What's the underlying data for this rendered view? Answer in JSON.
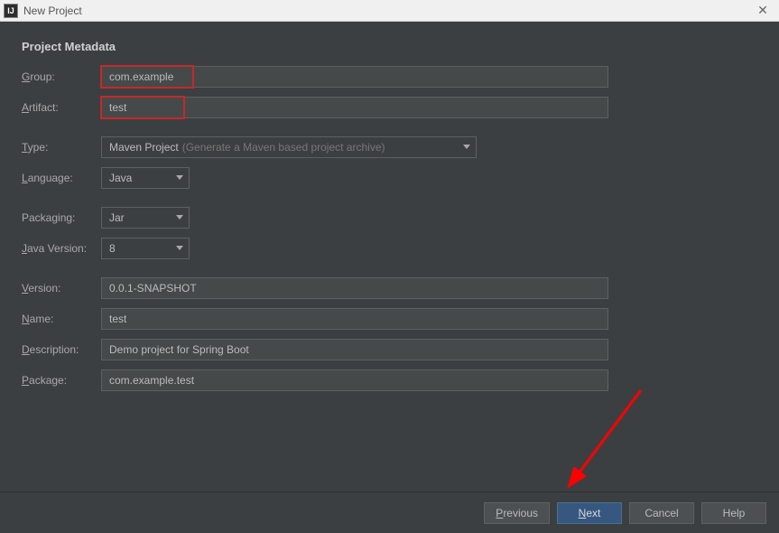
{
  "window": {
    "title": "New Project",
    "app_icon_text": "IJ"
  },
  "section_title": "Project Metadata",
  "labels": {
    "group": "Group:",
    "artifact": "Artifact:",
    "type": "Type:",
    "language": "Language:",
    "packaging": "Packaging:",
    "java_version": "Java Version:",
    "version": "Version:",
    "name": "Name:",
    "description": "Description:",
    "package": "Package:"
  },
  "mnemonics": {
    "group": "G",
    "artifact": "A",
    "type": "T",
    "language": "L",
    "java_version": "J",
    "version": "V",
    "name": "N",
    "description": "D",
    "package": "P"
  },
  "fields": {
    "group": "com.example",
    "artifact": "test",
    "type_value": "Maven Project",
    "type_hint": "(Generate a Maven based project archive)",
    "language": "Java",
    "packaging": "Jar",
    "java_version": "8",
    "version": "0.0.1-SNAPSHOT",
    "name": "test",
    "description": "Demo project for Spring Boot",
    "package": "com.example.test"
  },
  "buttons": {
    "previous": "Previous",
    "next": "Next",
    "cancel": "Cancel",
    "help": "Help"
  }
}
